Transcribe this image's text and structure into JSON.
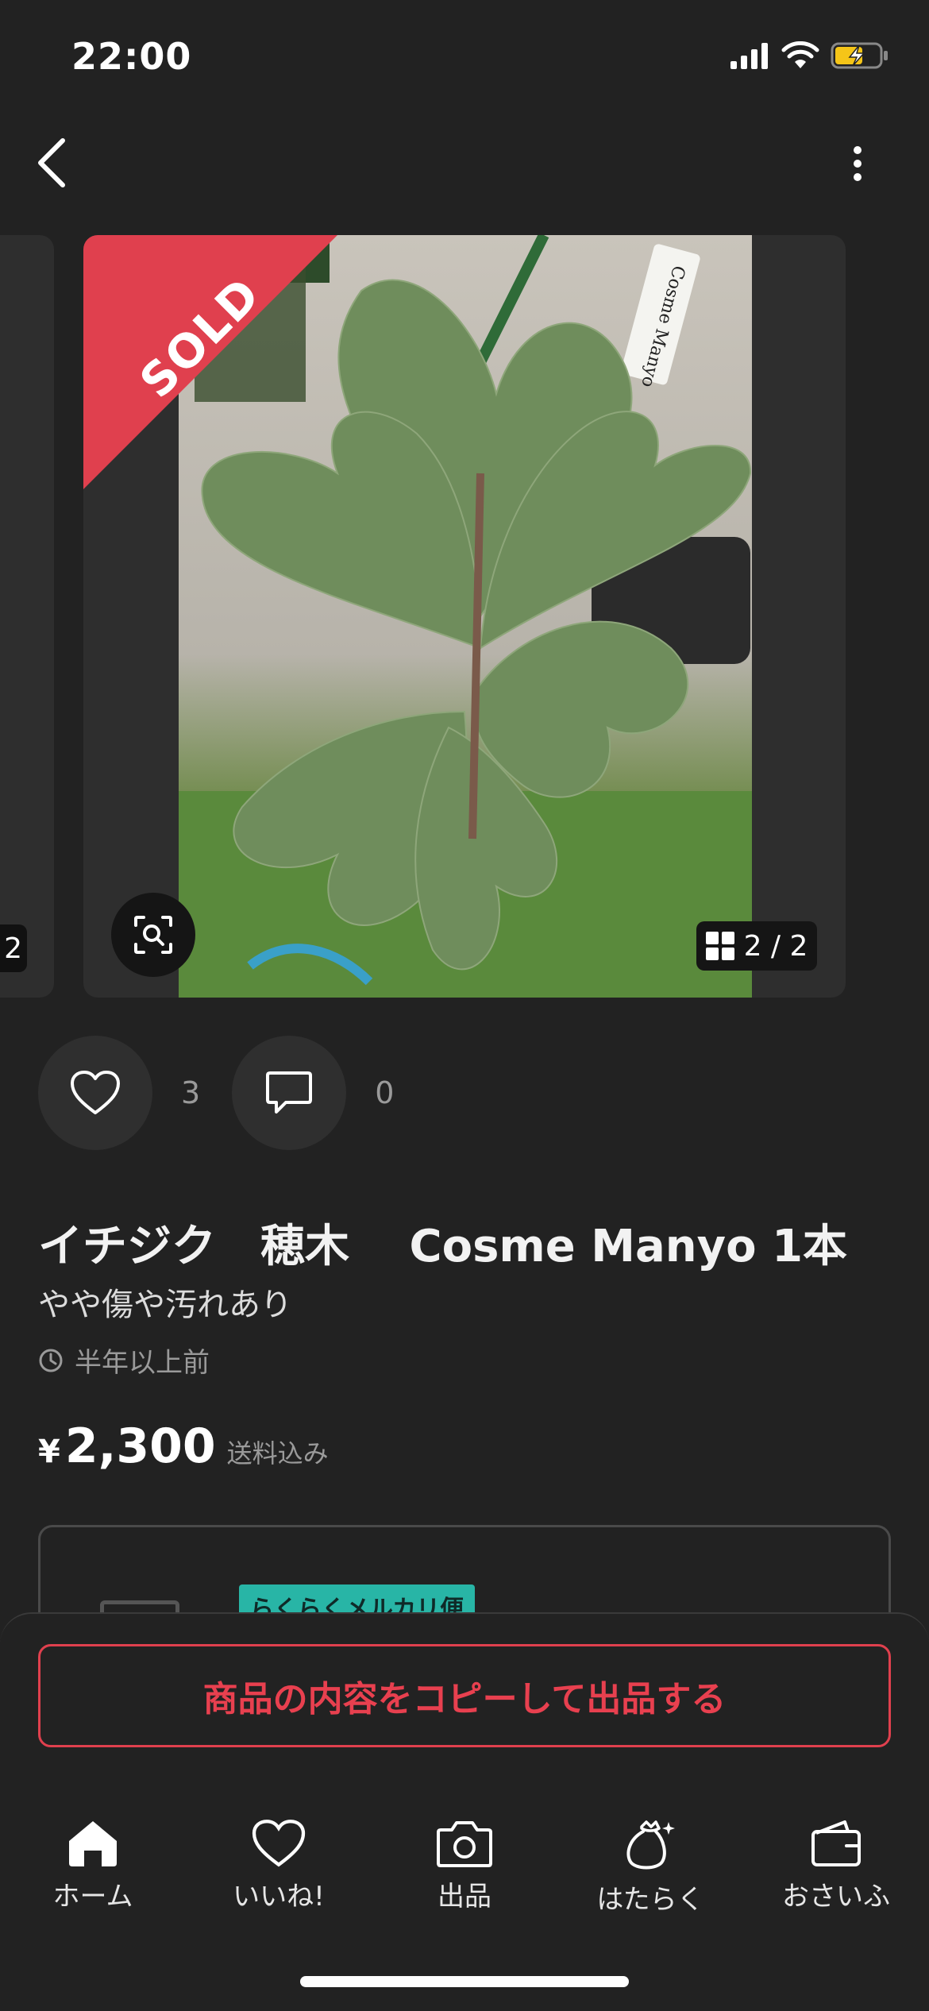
{
  "status_bar": {
    "time": "22:00"
  },
  "listing": {
    "sold_badge": "SOLD",
    "image_counter": "2 / 2",
    "prev_image_counter": "2",
    "like_count": "3",
    "comment_count": "0",
    "title": "イチジク　穂木　 Cosme Manyo 1本",
    "condition": "やや傷や汚れあり",
    "posted": "半年以上前",
    "price_symbol": "¥",
    "price": "2,300",
    "price_note": "送料込み",
    "shipping_tag": "らくらくメルカリ便",
    "photo_tag_text": "Cosme Manyo"
  },
  "actions": {
    "copy_listing": "商品の内容をコピーして出品する"
  },
  "tabs": [
    {
      "label": "ホーム",
      "icon": "home-icon"
    },
    {
      "label": "いいね!",
      "icon": "heart-icon"
    },
    {
      "label": "出品",
      "icon": "camera-icon"
    },
    {
      "label": "はたらく",
      "icon": "money-bag-icon"
    },
    {
      "label": "おさいふ",
      "icon": "wallet-icon"
    }
  ],
  "colors": {
    "accent_red": "#e0404e",
    "background": "#222222",
    "sold_ribbon": "#e0404e",
    "shipping_tag": "#28b5a6"
  }
}
